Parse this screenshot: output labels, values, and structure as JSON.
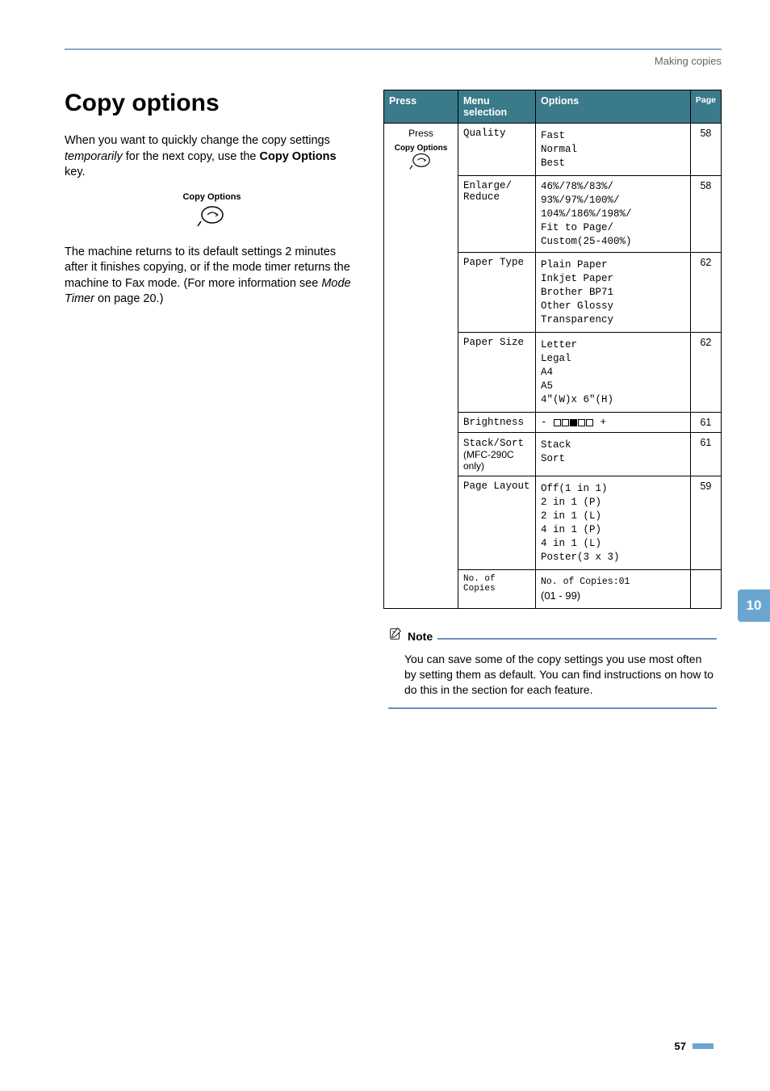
{
  "header": {
    "section": "Making copies"
  },
  "left": {
    "title": "Copy options",
    "para1_a": "When you want to quickly change the copy settings ",
    "para1_b": "temporarily",
    "para1_c": " for the next copy, use the ",
    "para1_d": "Copy Options",
    "para1_e": " key.",
    "copy_options_label": "Copy Options",
    "para2_a": "The machine returns to its default settings 2 minutes after it finishes copying, or if the mode timer returns the machine to Fax mode. (For more information see ",
    "para2_b": "Mode Timer",
    "para2_c": " on page 20.)"
  },
  "table": {
    "headers": {
      "press": "Press",
      "menu": "Menu selection",
      "options": "Options",
      "page": "Page"
    },
    "press_cell": {
      "line1": "Press",
      "line2": "Copy Options"
    },
    "rows": [
      {
        "menu": "Quality",
        "options": [
          "Fast",
          "Normal",
          "Best"
        ],
        "page": "58"
      },
      {
        "menu": "Enlarge/\nReduce",
        "options_inline": "46%/78%/83%/\n93%/97%/100%/\n104%/186%/198%/\nFit to Page/\nCustom(25-400%)",
        "page": "58"
      },
      {
        "menu": "Paper Type",
        "options": [
          "Plain Paper",
          "Inkjet Paper",
          "Brother BP71",
          "Other Glossy",
          "Transparency"
        ],
        "page": "62"
      },
      {
        "menu": "Paper Size",
        "options": [
          "Letter",
          "Legal",
          "A4",
          "A5",
          "4\"(W)x 6\"(H)"
        ],
        "page": "62"
      },
      {
        "menu": "Brightness",
        "brightness": true,
        "page": "61"
      },
      {
        "menu": "Stack/Sort",
        "menu_extra": "(MFC-290C only)",
        "options": [
          "Stack",
          "Sort"
        ],
        "page": "61"
      },
      {
        "menu": "Page Layout",
        "options": [
          "Off(1 in 1)",
          "2 in 1 (P)",
          "2 in 1 (L)",
          "4 in 1 (P)",
          "4 in 1 (L)",
          "Poster(3 x 3)"
        ],
        "page": "59"
      },
      {
        "menu": "No. of Copies",
        "options": [
          "No. of Copies:01"
        ],
        "extra_nonmono": "(01 - 99)",
        "page": ""
      }
    ]
  },
  "note": {
    "label": "Note",
    "text": "You can save some of the copy settings you use most often by setting them as default. You can find instructions on how to do this in the section for each feature."
  },
  "side_tab": "10",
  "page_number": "57"
}
